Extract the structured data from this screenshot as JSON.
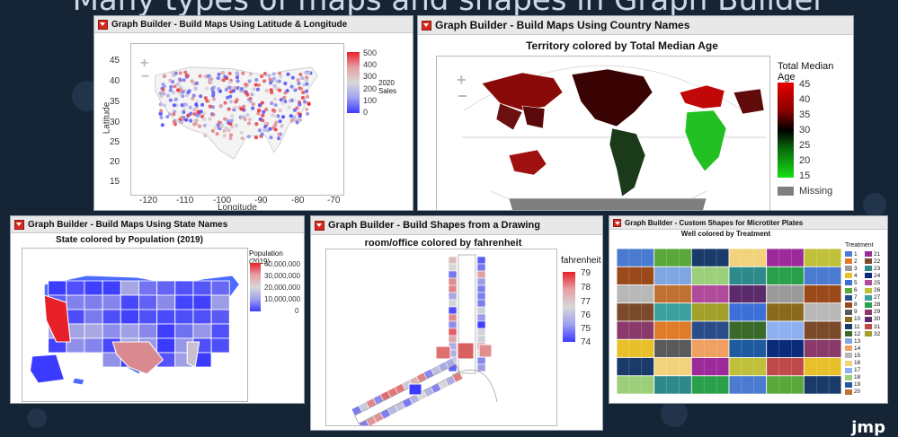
{
  "slide": {
    "title": "Many types of maps and shapes in Graph Builder",
    "logo": "jmp"
  },
  "p1": {
    "header": "Graph Builder - Build Maps Using Latitude & Longitude",
    "xlabel": "Longitude",
    "ylabel": "Latitude",
    "xticks": [
      "-120",
      "-110",
      "-100",
      "-90",
      "-80",
      "-70"
    ],
    "yticks": [
      "45",
      "40",
      "35",
      "30",
      "25",
      "20",
      "15"
    ],
    "legend_title": "2020 Sales",
    "legend_ticks": [
      "500",
      "400",
      "300",
      "200",
      "100",
      "0"
    ],
    "colors": {
      "high": "#e8202a",
      "low": "#3b3bff",
      "mid": "#d8d8d8"
    }
  },
  "p2": {
    "header": "Graph Builder - Build Maps Using Country Names",
    "title": "Territory colored by Total Median Age",
    "legend_title": "Total Median Age",
    "legend_ticks": [
      "45",
      "40",
      "35",
      "30",
      "25",
      "20",
      "15"
    ],
    "missing_label": "Missing",
    "colors": {
      "high": "#e60000",
      "mid": "#000000",
      "low": "#14e014",
      "missing": "#7f7f7f"
    }
  },
  "p3": {
    "header": "Graph Builder - Build Maps Using State Names",
    "title": "State colored by Population (2019)",
    "legend_title": "Population (2019)",
    "legend_ticks": [
      "40,000,000",
      "30,000,000",
      "20,000,000",
      "10,000,000",
      "0"
    ]
  },
  "p4": {
    "header": "Graph Builder - Build Shapes from a Drawing",
    "title": "room/office colored by fahrenheit",
    "legend_title": "fahrenheit",
    "legend_ticks": [
      "79",
      "78",
      "77",
      "76",
      "75",
      "74"
    ]
  },
  "p5": {
    "header": "Graph Builder - Custom Shapes for Microtiter Plates",
    "title": "Well colored by Treatment",
    "legend_title": "Treatment",
    "treatments": [
      "1",
      "2",
      "3",
      "4",
      "5",
      "6",
      "7",
      "8",
      "9",
      "10",
      "11",
      "12",
      "13",
      "14",
      "15",
      "16",
      "17",
      "18",
      "19",
      "20",
      "21",
      "22",
      "23",
      "24",
      "25",
      "26",
      "27",
      "28",
      "29",
      "30",
      "31",
      "32"
    ],
    "treatment_colors": [
      "#4a7bd0",
      "#e07b2a",
      "#9a9a9a",
      "#e8c02a",
      "#3d6fd8",
      "#5aa83a",
      "#2a4d8a",
      "#9a4a1a",
      "#5a5a5a",
      "#8a6a1a",
      "#1a3a6a",
      "#3a6a2a",
      "#7fa6e0",
      "#f0a060",
      "#b8b8b8",
      "#f2d27a",
      "#8fb0f0",
      "#9ccf7a",
      "#1e5aa0",
      "#c07030",
      "#9c2a9a",
      "#7a4a2a",
      "#2e8a8a",
      "#0a2a7a",
      "#b04a9a",
      "#c0c03a",
      "#3aa0a0",
      "#2aa04a",
      "#8a3a6a",
      "#5a2a6a",
      "#c04a4a",
      "#a0a02a"
    ]
  }
}
